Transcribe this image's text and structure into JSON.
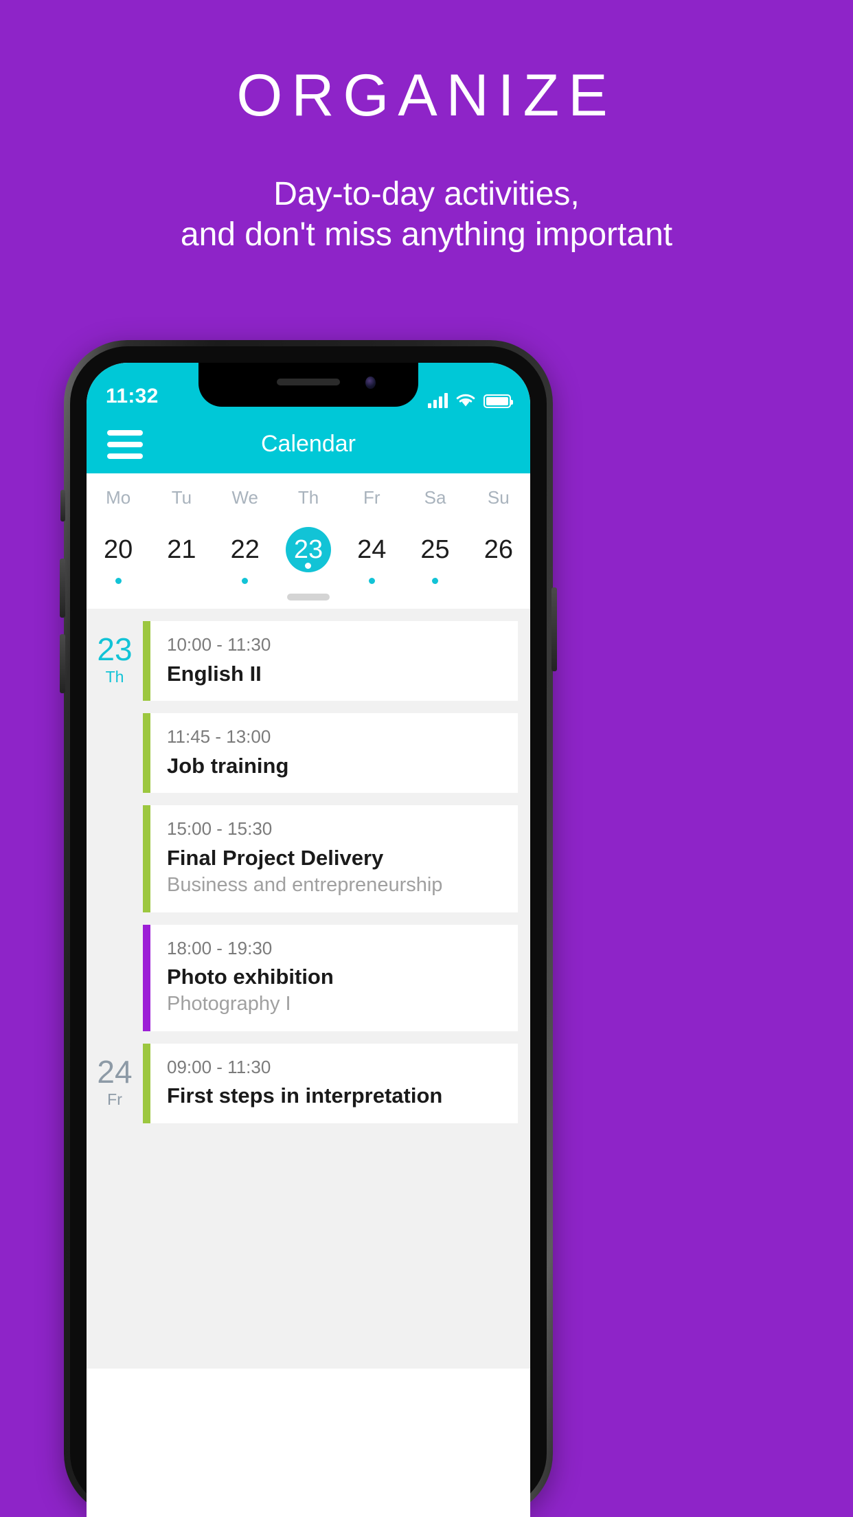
{
  "promo": {
    "title": "ORGANIZE",
    "subtitle_line1": "Day-to-day activities,",
    "subtitle_line2": "and don't miss anything important",
    "background_color": "#8E24C8"
  },
  "phone": {
    "statusbar": {
      "time": "11:32",
      "signal_icon": "signal-bars-icon",
      "wifi_icon": "wifi-icon",
      "battery_icon": "battery-full-icon"
    },
    "appbar": {
      "menu_icon": "hamburger-menu-icon",
      "title": "Calendar",
      "background_color": "#00C8D7"
    },
    "week_strip": {
      "days": [
        {
          "name": "Mo",
          "date": "20",
          "selected": false,
          "has_event": true
        },
        {
          "name": "Tu",
          "date": "21",
          "selected": false,
          "has_event": false
        },
        {
          "name": "We",
          "date": "22",
          "selected": false,
          "has_event": true
        },
        {
          "name": "Th",
          "date": "23",
          "selected": true,
          "has_event": true
        },
        {
          "name": "Fr",
          "date": "24",
          "selected": false,
          "has_event": true
        },
        {
          "name": "Sa",
          "date": "25",
          "selected": false,
          "has_event": true
        },
        {
          "name": "Su",
          "date": "26",
          "selected": false,
          "has_event": false
        }
      ],
      "accent_color": "#12C3D6"
    },
    "agenda": {
      "events": [
        {
          "date_num": "23",
          "date_dow": "Th",
          "show_date": true,
          "date_style": "current",
          "time": "10:00 - 11:30",
          "title": "English II",
          "subtitle": "",
          "accent_color": "#9CC73F"
        },
        {
          "date_num": "",
          "date_dow": "",
          "show_date": false,
          "date_style": "current",
          "time": "11:45 - 13:00",
          "title": "Job training",
          "subtitle": "",
          "accent_color": "#9CC73F"
        },
        {
          "date_num": "",
          "date_dow": "",
          "show_date": false,
          "date_style": "current",
          "time": "15:00 - 15:30",
          "title": "Final Project Delivery",
          "subtitle": "Business and entrepreneurship",
          "accent_color": "#9CC73F"
        },
        {
          "date_num": "",
          "date_dow": "",
          "show_date": false,
          "date_style": "current",
          "time": "18:00 - 19:30",
          "title": "Photo exhibition",
          "subtitle": "Photography I",
          "accent_color": "#9C1FD6"
        },
        {
          "date_num": "24",
          "date_dow": "Fr",
          "show_date": true,
          "date_style": "past",
          "time": "09:00 - 11:30",
          "title": "First steps in interpretation",
          "subtitle": "",
          "accent_color": "#9CC73F"
        }
      ]
    }
  }
}
